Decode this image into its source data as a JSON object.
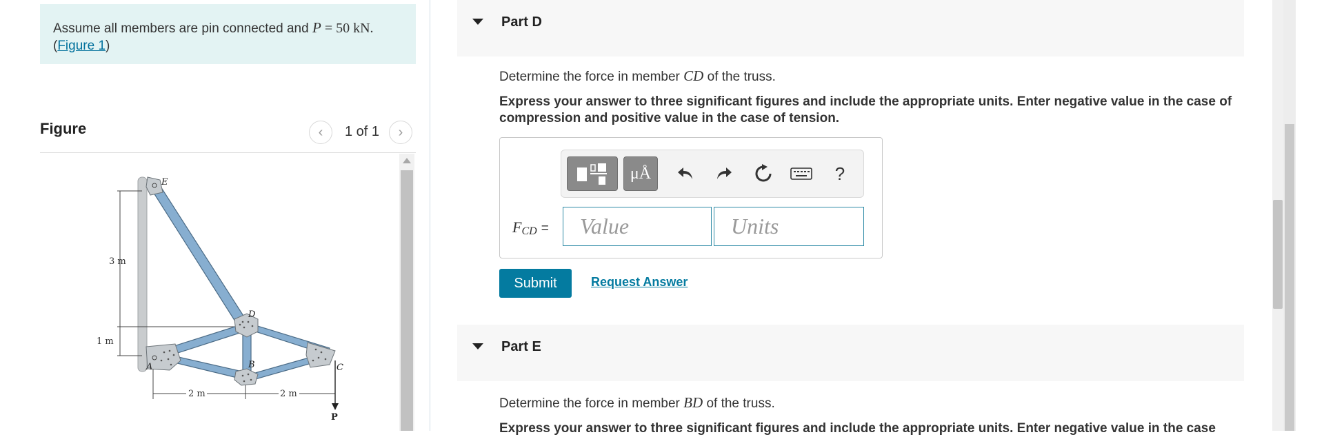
{
  "problem": {
    "text_before": "Assume all members are pin connected and ",
    "math_var": "P",
    "math_rest": " = 50 kN.",
    "open_paren": "(",
    "figure_link": "Figure 1",
    "close_paren": ")"
  },
  "figure": {
    "title": "Figure",
    "pager": "1 of 1",
    "labels": {
      "E": "E",
      "D": "D",
      "A": "A",
      "B": "B",
      "C": "C",
      "P": "P",
      "dim_3m": "3 m",
      "dim_1m": "1 m",
      "dim_2m_left": "2 m",
      "dim_2m_right": "2 m"
    }
  },
  "parts": [
    {
      "title": "Part D",
      "question_prefix": "Determine the force in member ",
      "member": "CD",
      "question_suffix": " of the truss.",
      "instructions": "Express your answer to three significant figures and include the appropriate units. Enter negative value in the case of compression and positive value in the case of tension.",
      "answer_label_var": "F",
      "answer_label_sub": "CD",
      "answer_label_eq": "=",
      "value_placeholder": "Value",
      "units_placeholder": "Units",
      "submit_label": "Submit",
      "request_label": "Request Answer"
    },
    {
      "title": "Part E",
      "question_prefix": "Determine the force in member ",
      "member": "BD",
      "question_suffix": " of the truss.",
      "instructions": "Express your answer to three significant figures and include the appropriate units. Enter negative value in the case"
    }
  ],
  "toolbar": {
    "units_button": "μÅ",
    "help": "?"
  },
  "colors": {
    "accent": "#047ba0",
    "problem_bg": "#e3f3f3",
    "member_blue": "#7fa7c9"
  }
}
